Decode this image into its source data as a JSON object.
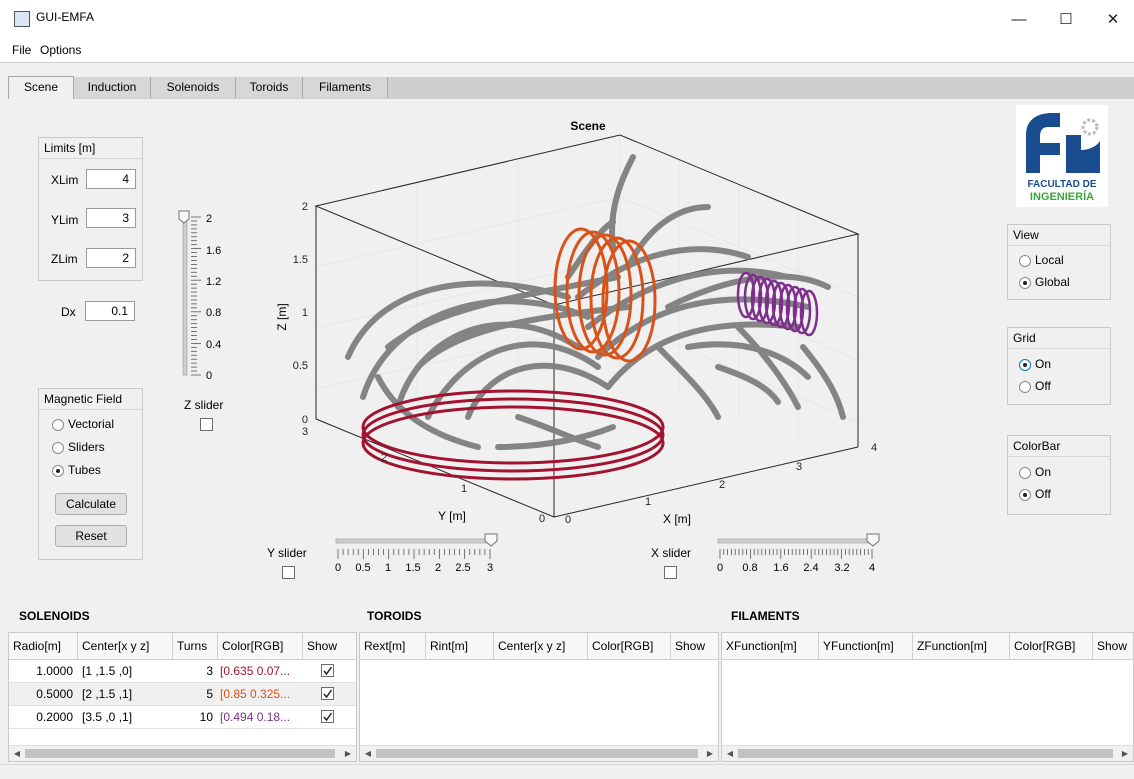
{
  "window": {
    "title": "GUI-EMFA",
    "minimize": "—",
    "maximize": "☐",
    "close": "✕"
  },
  "menu": {
    "file": "File",
    "options": "Options"
  },
  "tabs": [
    "Scene",
    "Induction",
    "Solenoids",
    "Toroids",
    "Filaments"
  ],
  "limits": {
    "title": "Limits [m]",
    "xlim_label": "XLim",
    "xlim": "4",
    "ylim_label": "YLim",
    "ylim": "3",
    "zlim_label": "ZLim",
    "zlim": "2"
  },
  "dx": {
    "label": "Dx",
    "value": "0.1"
  },
  "zslider": {
    "ticks": [
      "2",
      "1.6",
      "1.2",
      "0.8",
      "0.4",
      "0"
    ],
    "label": "Z slider",
    "level": 1.0
  },
  "magnetic_field": {
    "title": "Magnetic Field",
    "options": [
      "Vectorial",
      "Sliders",
      "Tubes"
    ],
    "selected": "Tubes",
    "calculate": "Calculate",
    "reset": "Reset"
  },
  "plot": {
    "title": "Scene",
    "xlabel": "X [m]",
    "ylabel": "Y [m]",
    "zlabel": "Z [m]",
    "zticks": [
      "2",
      "1.5",
      "1",
      "0.5",
      "0"
    ],
    "yticks": [
      "3",
      "2",
      "1",
      "0"
    ],
    "xticks": [
      "0",
      "1",
      "2",
      "3",
      "4"
    ],
    "colors": {
      "solenoid1": "#a2132f",
      "solenoid2": "#d95319",
      "solenoid3": "#7e2f8e",
      "tubes": "#7f7f7f"
    }
  },
  "yslider": {
    "label": "Y slider",
    "ticks": [
      "0",
      "0.5",
      "1",
      "1.5",
      "2",
      "2.5",
      "3"
    ],
    "level": 1.0
  },
  "xslider": {
    "label": "X slider",
    "ticks": [
      "0",
      "0.8",
      "1.6",
      "2.4",
      "3.2",
      "4"
    ],
    "level": 1.0
  },
  "logo": {
    "line1": "FACULTAD DE",
    "line2": "INGENIERÍA"
  },
  "view": {
    "title": "View",
    "options": [
      "Local",
      "Global"
    ],
    "selected": "Global"
  },
  "grid": {
    "title": "Grid",
    "options": [
      "On",
      "Off"
    ],
    "selected": "On"
  },
  "colorbar": {
    "title": "ColorBar",
    "options": [
      "On",
      "Off"
    ],
    "selected": "Off"
  },
  "solenoids": {
    "title": "SOLENOIDS",
    "columns": [
      "Radio[m]",
      "Center[x y z]",
      "Turns",
      "Color[RGB]",
      "Show"
    ],
    "rows": [
      {
        "radio": "1.0000",
        "center": "[1 ,1.5 ,0]",
        "turns": "3",
        "color": "[0.635 0.07...",
        "color_hex": "#a2132f",
        "show": true
      },
      {
        "radio": "0.5000",
        "center": "[2 ,1.5 ,1]",
        "turns": "5",
        "color": "[0.85 0.325...",
        "color_hex": "#d95319",
        "show": true
      },
      {
        "radio": "0.2000",
        "center": "[3.5 ,0 ,1]",
        "turns": "10",
        "color": "[0.494 0.18...",
        "color_hex": "#7e2f8e",
        "show": true
      }
    ]
  },
  "toroids": {
    "title": "TOROIDS",
    "columns": [
      "Rext[m]",
      "Rint[m]",
      "Center[x y z]",
      "Color[RGB]",
      "Show"
    ]
  },
  "filaments": {
    "title": "FILAMENTS",
    "columns": [
      "XFunction[m]",
      "YFunction[m]",
      "ZFunction[m]",
      "Color[RGB]",
      "Show"
    ]
  }
}
